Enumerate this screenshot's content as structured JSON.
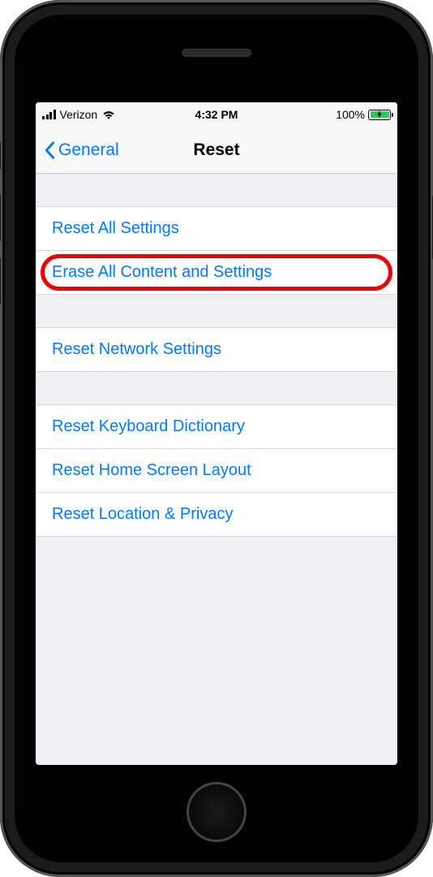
{
  "status": {
    "carrier": "Verizon",
    "time": "4:32 PM",
    "battery_pct": "100%"
  },
  "nav": {
    "back_label": "General",
    "title": "Reset"
  },
  "groups": [
    {
      "rows": [
        {
          "label": "Reset All Settings"
        },
        {
          "label": "Erase All Content and Settings",
          "highlighted": true
        }
      ]
    },
    {
      "rows": [
        {
          "label": "Reset Network Settings"
        }
      ]
    },
    {
      "rows": [
        {
          "label": "Reset Keyboard Dictionary"
        },
        {
          "label": "Reset Home Screen Layout"
        },
        {
          "label": "Reset Location & Privacy"
        }
      ]
    }
  ]
}
